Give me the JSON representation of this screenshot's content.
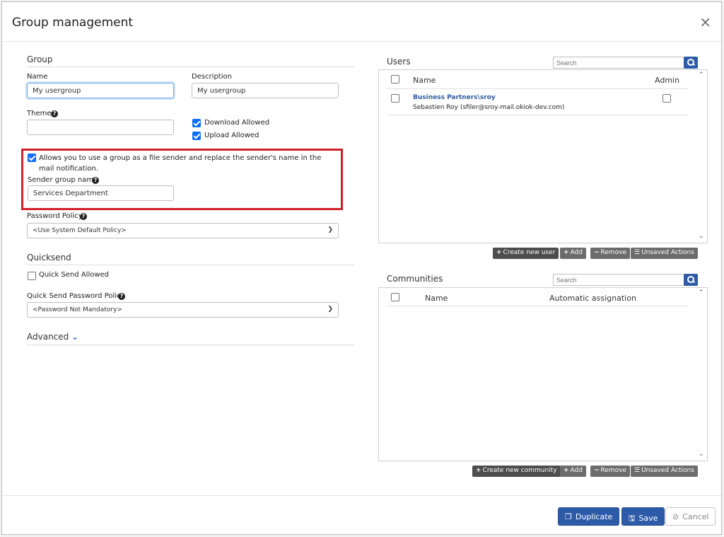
{
  "dialog": {
    "title": "Group management",
    "close_icon": "×"
  },
  "group": {
    "section_title": "Group",
    "name_label": "Name",
    "name_value": "My usergroup",
    "description_label": "Description",
    "description_value": "My usergroup",
    "theme_label": "Theme",
    "theme_value": "",
    "download_allowed_label": "Download Allowed",
    "download_allowed_checked": true,
    "upload_allowed_label": "Upload Allowed",
    "upload_allowed_checked": true,
    "sender_checkbox_label": "Allows you to use a group as a file sender and replace the sender's name in the mail notification.",
    "sender_checkbox_checked": true,
    "sender_group_name_label": "Sender group name",
    "sender_group_name_value": "Services Department",
    "password_policy_label": "Password Policy",
    "password_policy_value": "<Use System Default Policy>"
  },
  "quicksend": {
    "section_title": "Quicksend",
    "quick_send_allowed_label": "Quick Send Allowed",
    "quick_send_allowed_checked": false,
    "quick_send_password_policy_label": "Quick Send Password Policy",
    "quick_send_password_policy_value": "<Password Not Mandatory>"
  },
  "advanced": {
    "label": "Advanced"
  },
  "users": {
    "label": "Users",
    "search_placeholder": "Search",
    "col_name": "Name",
    "col_admin": "Admin",
    "rows": [
      {
        "name": "Business Partners\\sroy",
        "detail": "Sebastien Roy (sfiler@sroy-mail.okiok-dev.com)",
        "admin": false
      }
    ],
    "buttons": {
      "create": "Create new user",
      "add": "Add",
      "remove": "Remove",
      "unsaved": "Unsaved Actions"
    }
  },
  "communities": {
    "label": "Communities",
    "search_placeholder": "Search",
    "col_name": "Name",
    "col_assignation": "Automatic assignation",
    "buttons": {
      "create": "Create new community",
      "add": "Add",
      "remove": "Remove",
      "unsaved": "Unsaved Actions"
    }
  },
  "footer": {
    "duplicate": "Duplicate",
    "save": "Save",
    "cancel": "Cancel"
  },
  "colors": {
    "primary": "#2d5ba7",
    "highlight_border": "#d0202a",
    "checkbox": "#0d6efd"
  }
}
